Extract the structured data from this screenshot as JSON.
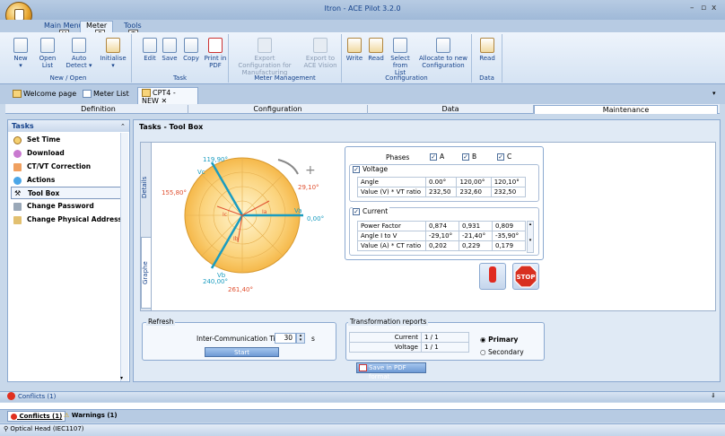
{
  "window": {
    "title": "Itron - ACE Pilot 3.2.0"
  },
  "menu": {
    "tabs": [
      {
        "label": "Main Menu",
        "key": "M"
      },
      {
        "label": "Meter",
        "key": "E"
      },
      {
        "label": "Tools",
        "key": "T"
      }
    ]
  },
  "ribbon": {
    "groups": [
      {
        "label": "New / Open",
        "buttons": [
          "New",
          "Open List",
          "Auto Detect",
          "Initialise"
        ]
      },
      {
        "label": "Task",
        "buttons": [
          "Edit",
          "Save",
          "Copy",
          "Print in PDF"
        ]
      },
      {
        "label": "Meter Management",
        "buttons": [
          "Export Configuration for Manufacturing",
          "Export to ACE Vision"
        ]
      },
      {
        "label": "Configuration",
        "buttons": [
          "Write",
          "Read",
          "Select from List",
          "Allocate to new Configuration"
        ]
      },
      {
        "label": "Data",
        "buttons": [
          "Read"
        ]
      }
    ]
  },
  "doc_tabs": [
    {
      "label": "Welcome page"
    },
    {
      "label": "Meter List"
    },
    {
      "label": "CPT4 - NEW"
    }
  ],
  "sub_tabs": [
    "Definition",
    "Configuration",
    "Data",
    "Maintenance"
  ],
  "tasks": {
    "header": "Tasks",
    "items": [
      "Set Time",
      "Download",
      "CT/VT Correction",
      "Actions",
      "Tool Box",
      "Change Password",
      "Change Physical Address"
    ]
  },
  "main": {
    "title": "Tasks - Tool Box",
    "vtabs": [
      "Details",
      "Graphe"
    ],
    "phasor": {
      "labels": {
        "va": "Va",
        "vb": "Vb",
        "vc": "Vc",
        "ia": "Ia",
        "ib": "Ib",
        "ic": "Ic"
      },
      "angles": {
        "v_top": "119,90°",
        "v_right": "0,00°",
        "v_bottom": "240,00°",
        "i_left": "155,80°",
        "i_right": "29,10°",
        "i_bottom": "261,40°"
      }
    },
    "phases": {
      "label": "Phases",
      "items": [
        "A",
        "B",
        "C"
      ]
    },
    "voltage": {
      "label": "Voltage",
      "rows": [
        {
          "name": "Angle",
          "values": [
            "0.00°",
            "120,00°",
            "120,10°"
          ]
        },
        {
          "name": "Value (V) * VT ratio",
          "values": [
            "232,50",
            "232,60",
            "232,50"
          ]
        }
      ]
    },
    "current": {
      "label": "Current",
      "rows": [
        {
          "name": "Power Factor",
          "values": [
            "0,874",
            "0,931",
            "0,809"
          ]
        },
        {
          "name": "Angle I to V",
          "values": [
            "-29,10°",
            "-21,40°",
            "-35,90°"
          ]
        },
        {
          "name": "Value (A) * CT ratio",
          "values": [
            "0,202",
            "0,229",
            "0,179"
          ]
        }
      ]
    },
    "stop_label": "STOP",
    "refresh": {
      "label": "Refresh",
      "interval_label": "Inter-Communication Time",
      "interval_value": "30",
      "unit": "s",
      "start": "Start"
    },
    "transformation": {
      "label": "Transformation reports",
      "current_label": "Current",
      "current_value": "1 / 1",
      "voltage_label": "Voltage",
      "voltage_value": "1 / 1",
      "primary": "Primary",
      "secondary": "Secondary"
    },
    "save_pdf": "Save in PDF format"
  },
  "conflicts_bar": {
    "label": "Conflicts (1)",
    "pin": "⇓"
  },
  "bottom_tabs": [
    {
      "label": "Conflicts (1)"
    },
    {
      "label": "Warnings (1)"
    }
  ],
  "status": {
    "text": "Optical Head (IEC1107)"
  }
}
